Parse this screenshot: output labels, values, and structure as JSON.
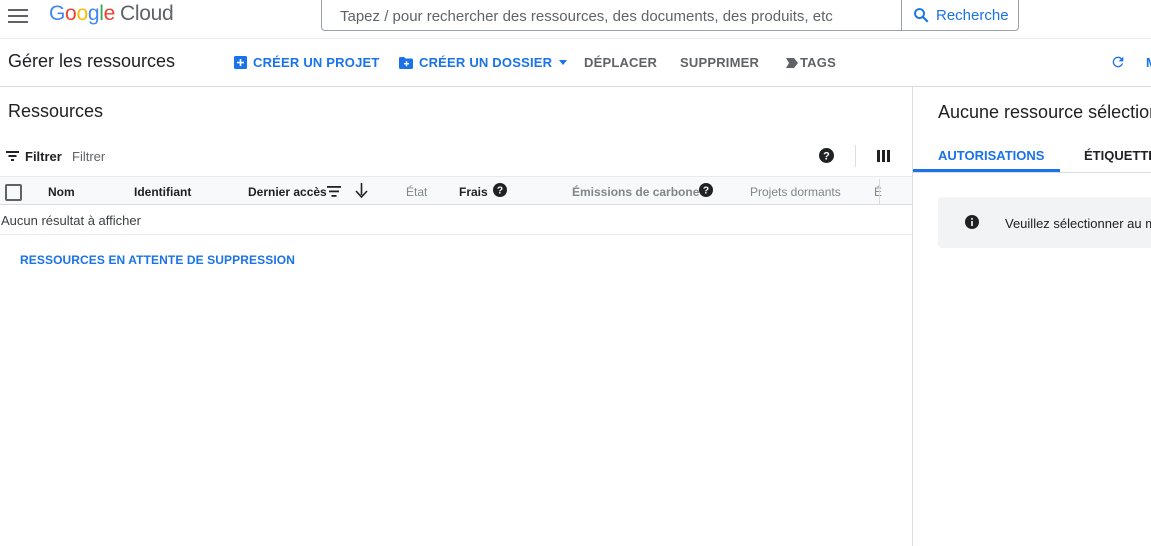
{
  "header": {
    "logo_letters": [
      "G",
      "o",
      "o",
      "g",
      "l",
      "e"
    ],
    "logo_product": "Cloud",
    "search_placeholder": "Tapez / pour rechercher des ressources, des documents, des produits, etc",
    "search_button": "Recherche"
  },
  "toolbar": {
    "title": "Gérer les ressources",
    "create_project": "CRÉER UN PROJET",
    "create_folder": "CRÉER UN DOSSIER",
    "move": "DÉPLACER",
    "delete": "SUPPRIMER",
    "tags": "TAGS",
    "overflow_letter": "M"
  },
  "resources": {
    "title": "Ressources",
    "filter_label": "Filtrer",
    "filter_placeholder": "Filtrer",
    "columns": [
      "Nom",
      "Identifiant",
      "Dernier accès",
      "État",
      "Frais",
      "Émissions de carbone",
      "Projets dormants",
      "É"
    ],
    "empty_message": "Aucun résultat à afficher",
    "pending_deletion_link": "RESSOURCES EN ATTENTE DE SUPPRESSION"
  },
  "side_panel": {
    "title": "Aucune ressource sélection",
    "tabs": [
      "AUTORISATIONS",
      "ÉTIQUETTE"
    ],
    "active_tab": "AUTORISATIONS",
    "info_message": "Veuillez sélectionner au m"
  },
  "colors": {
    "accent": "#1a73e8",
    "text": "#202124",
    "muted": "#5f6368"
  }
}
